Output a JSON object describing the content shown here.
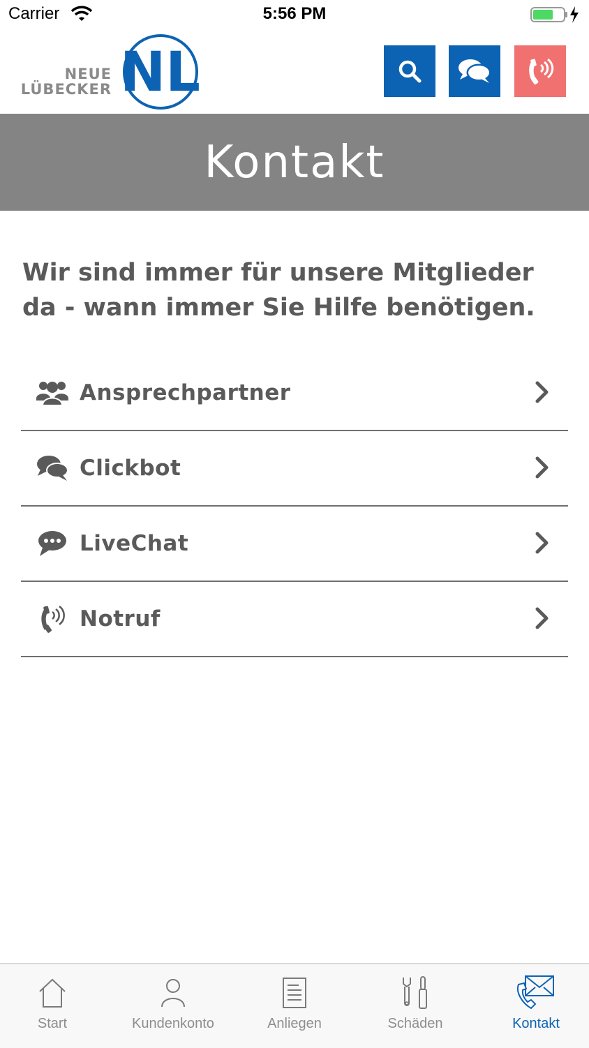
{
  "status": {
    "carrier": "Carrier",
    "time": "5:56 PM"
  },
  "brand": {
    "line1": "NEUE",
    "line2": "LÜBECKER",
    "mark": "NL",
    "blue": "#0d63b3",
    "red": "#f07170"
  },
  "header_buttons": [
    {
      "icon": "search-icon"
    },
    {
      "icon": "chat-icon"
    },
    {
      "icon": "phone-ring-icon"
    }
  ],
  "page": {
    "title": "Kontakt",
    "intro": "Wir sind immer für unsere Mitglieder da - wann immer Sie Hilfe benötigen."
  },
  "contact_items": [
    {
      "label": "Ansprechpartner",
      "icon": "users-icon"
    },
    {
      "label": "Clickbot",
      "icon": "comments-icon"
    },
    {
      "label": "LiveChat",
      "icon": "speech-bubble-icon"
    },
    {
      "label": "Notruf",
      "icon": "phone-ring-icon"
    }
  ],
  "tabbar": {
    "items": [
      {
        "label": "Start",
        "icon": "home-icon"
      },
      {
        "label": "Kundenkonto",
        "icon": "user-icon"
      },
      {
        "label": "Anliegen",
        "icon": "document-icon"
      },
      {
        "label": "Schäden",
        "icon": "tools-icon"
      },
      {
        "label": "Kontakt",
        "icon": "mail-phone-icon",
        "active": true
      }
    ]
  }
}
